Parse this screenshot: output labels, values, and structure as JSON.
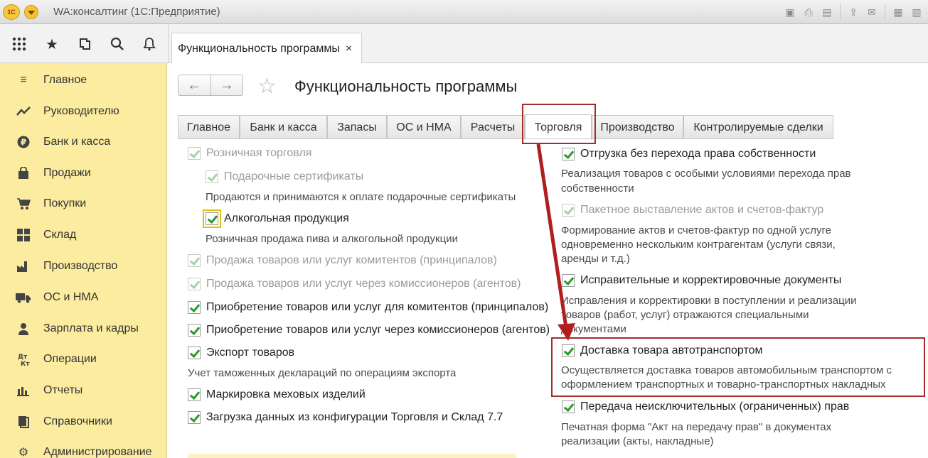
{
  "app": {
    "title": "WA:консалтинг  (1С:Предприятие)",
    "logo_text": "1С"
  },
  "doc_tab": {
    "label": "Функциональность программы",
    "close": "×"
  },
  "sidebar": {
    "items": [
      {
        "label": "Главное",
        "icon": "menu-icon"
      },
      {
        "label": "Руководителю",
        "icon": "trend-icon"
      },
      {
        "label": "Банк и касса",
        "icon": "ruble-icon"
      },
      {
        "label": "Продажи",
        "icon": "bag-icon"
      },
      {
        "label": "Покупки",
        "icon": "cart-icon"
      },
      {
        "label": "Склад",
        "icon": "grid-icon"
      },
      {
        "label": "Производство",
        "icon": "factory-icon"
      },
      {
        "label": "ОС и НМА",
        "icon": "truck-icon"
      },
      {
        "label": "Зарплата и кадры",
        "icon": "person-icon"
      },
      {
        "label": "Операции",
        "icon": "dt-kt-icon"
      },
      {
        "label": "Отчеты",
        "icon": "bar-chart-icon"
      },
      {
        "label": "Справочники",
        "icon": "books-icon"
      },
      {
        "label": "Администрирование",
        "icon": "gear-icon"
      }
    ]
  },
  "page": {
    "title": "Функциональность программы"
  },
  "tabs": [
    {
      "label": "Главное"
    },
    {
      "label": "Банк и касса"
    },
    {
      "label": "Запасы"
    },
    {
      "label": "ОС и НМА"
    },
    {
      "label": "Расчеты"
    },
    {
      "label": "Торговля",
      "active": true
    },
    {
      "label": "Производство"
    },
    {
      "label": "Контролируемые сделки"
    }
  ],
  "left_options": {
    "retail": "Розничная торговля",
    "gift_cards": "Подарочные сертификаты",
    "gift_cards_desc": "Продаются и принимаются к оплате подарочные сертификаты",
    "alcohol": "Алкогольная продукция",
    "alcohol_desc": "Розничная продажа пива и алкогольной продукции",
    "sale_principals": "Продажа товаров или услуг комитентов (принципалов)",
    "sale_agents": "Продажа товаров или услуг через комиссионеров (агентов)",
    "buy_principals": "Приобретение товаров или услуг для комитентов (принципалов)",
    "buy_agents": "Приобретение товаров или услуг через комиссионеров (агентов)",
    "export": "Экспорт товаров",
    "export_desc": "Учет таможенных деклараций по операциям экспорта",
    "fur": "Маркировка меховых изделий",
    "import77": "Загрузка данных из конфигурации Торговля и Склад 7.7"
  },
  "right_options": {
    "shipment": "Отгрузка без перехода права собственности",
    "shipment_desc1": "Реализация товаров с особыми условиями перехода прав",
    "shipment_desc2": "собственности",
    "batch": "Пакетное выставление актов и счетов-фактур",
    "batch_desc1": "Формирование актов и счетов-фактур по одной услуге",
    "batch_desc2": "одновременно нескольким контрагентам (услуги связи,",
    "batch_desc3": "аренды и т.д.)",
    "corrections": "Исправительные и корректировочные документы",
    "corrections_desc1": "Исправления и корректировки в поступлении и реализации",
    "corrections_desc2": "товаров (работ, услуг) отражаются специальными",
    "corrections_desc3": "документами",
    "delivery": "Доставка товара автотранспортом",
    "delivery_desc1": "Осуществляется доставка товаров автомобильным транспортом с",
    "delivery_desc2": "оформлением транспортных и товарно-транспортных накладных",
    "rights": "Передача неисключительных (ограниченных) прав",
    "rights_desc1": "Печатная форма \"Акт на передачу прав\" в документах",
    "rights_desc2": "реализации (акты, накладные)"
  },
  "colors": {
    "sidebar_bg": "#fbeca0",
    "highlight": "#a52a2a",
    "check": "#2a9a2a"
  }
}
